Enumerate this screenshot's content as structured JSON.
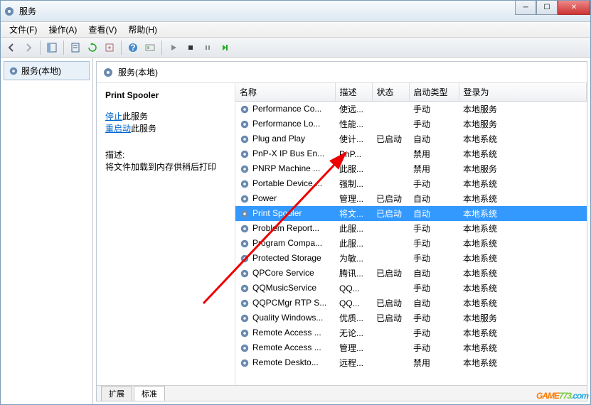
{
  "window": {
    "title": "服务"
  },
  "menu": {
    "file": "文件(F)",
    "action": "操作(A)",
    "view": "查看(V)",
    "help": "帮助(H)"
  },
  "tree": {
    "root": "服务(本地)"
  },
  "header": {
    "title": "服务(本地)"
  },
  "detail": {
    "name": "Print Spooler",
    "stop_link": "停止",
    "stop_suffix": "此服务",
    "restart_link": "重启动",
    "restart_suffix": "此服务",
    "desc_label": "描述:",
    "desc_text": "将文件加载到内存供稍后打印"
  },
  "columns": {
    "name": "名称",
    "desc": "描述",
    "status": "状态",
    "startup": "启动类型",
    "logon": "登录为"
  },
  "tabs": {
    "extended": "扩展",
    "standard": "标准"
  },
  "services": [
    {
      "name": "Performance Co...",
      "desc": "使远...",
      "status": "",
      "startup": "手动",
      "logon": "本地服务"
    },
    {
      "name": "Performance Lo...",
      "desc": "性能...",
      "status": "",
      "startup": "手动",
      "logon": "本地服务"
    },
    {
      "name": "Plug and Play",
      "desc": "使计...",
      "status": "已启动",
      "startup": "自动",
      "logon": "本地系统"
    },
    {
      "name": "PnP-X IP Bus En...",
      "desc": "PnP...",
      "status": "",
      "startup": "禁用",
      "logon": "本地系统"
    },
    {
      "name": "PNRP Machine ...",
      "desc": "此服...",
      "status": "",
      "startup": "禁用",
      "logon": "本地服务"
    },
    {
      "name": "Portable Device ...",
      "desc": "强制...",
      "status": "",
      "startup": "手动",
      "logon": "本地系统"
    },
    {
      "name": "Power",
      "desc": "管理...",
      "status": "已启动",
      "startup": "自动",
      "logon": "本地系统"
    },
    {
      "name": "Print Spooler",
      "desc": "将文...",
      "status": "已启动",
      "startup": "自动",
      "logon": "本地系统",
      "selected": true
    },
    {
      "name": "Problem Report...",
      "desc": "此服...",
      "status": "",
      "startup": "手动",
      "logon": "本地系统"
    },
    {
      "name": "Program Compa...",
      "desc": "此服...",
      "status": "",
      "startup": "手动",
      "logon": "本地系统"
    },
    {
      "name": "Protected Storage",
      "desc": "为敏...",
      "status": "",
      "startup": "手动",
      "logon": "本地系统"
    },
    {
      "name": "QPCore Service",
      "desc": "腾讯...",
      "status": "已启动",
      "startup": "自动",
      "logon": "本地系统"
    },
    {
      "name": "QQMusicService",
      "desc": "QQ...",
      "status": "",
      "startup": "手动",
      "logon": "本地系统"
    },
    {
      "name": "QQPCMgr RTP S...",
      "desc": "QQ...",
      "status": "已启动",
      "startup": "自动",
      "logon": "本地系统"
    },
    {
      "name": "Quality Windows...",
      "desc": "优质...",
      "status": "已启动",
      "startup": "手动",
      "logon": "本地服务"
    },
    {
      "name": "Remote Access ...",
      "desc": "无论...",
      "status": "",
      "startup": "手动",
      "logon": "本地系统"
    },
    {
      "name": "Remote Access ...",
      "desc": "管理...",
      "status": "",
      "startup": "手动",
      "logon": "本地系统"
    },
    {
      "name": "Remote Deskto...",
      "desc": "远程...",
      "status": "",
      "startup": "禁用",
      "logon": "本地系统"
    }
  ],
  "watermark": "GAME773.com"
}
